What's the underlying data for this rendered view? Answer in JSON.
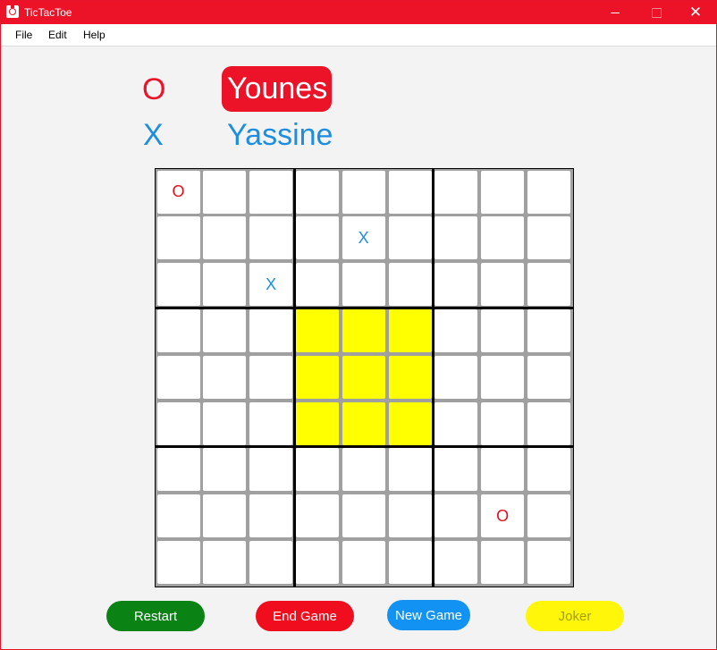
{
  "window": {
    "title": "TicTacToe",
    "close_glyph": "✕"
  },
  "menu": [
    "File",
    "Edit",
    "Help"
  ],
  "players": [
    {
      "symbol": "O",
      "name": "Younes",
      "color": "#ec1328",
      "active": true
    },
    {
      "symbol": "X",
      "name": "Yassine",
      "color": "#1c8de0",
      "active": false
    }
  ],
  "board": {
    "size": 9,
    "active_block": {
      "row": 1,
      "col": 1
    },
    "highlight_color": "#ffff00",
    "cells": [
      [
        "O",
        "",
        "",
        "",
        "",
        "",
        "",
        "",
        ""
      ],
      [
        "",
        "",
        "",
        "",
        "X",
        "",
        "",
        "",
        ""
      ],
      [
        "",
        "",
        "X",
        "",
        "",
        "",
        "",
        "",
        ""
      ],
      [
        "",
        "",
        "",
        "",
        "",
        "",
        "",
        "",
        ""
      ],
      [
        "",
        "",
        "",
        "",
        "",
        "",
        "",
        "",
        ""
      ],
      [
        "",
        "",
        "",
        "",
        "",
        "",
        "",
        "",
        ""
      ],
      [
        "",
        "",
        "",
        "",
        "",
        "",
        "",
        "",
        ""
      ],
      [
        "",
        "",
        "",
        "",
        "",
        "",
        "",
        "O",
        ""
      ],
      [
        "",
        "",
        "",
        "",
        "",
        "",
        "",
        "",
        ""
      ]
    ]
  },
  "buttons": {
    "restart": "Restart",
    "end_game": "End Game",
    "new_game": "New Game",
    "joker": "Joker"
  },
  "colors": {
    "titlebar": "#ec1328",
    "restart": "#0a8214",
    "end_game": "#ef0d1e",
    "new_game": "#1293f4",
    "joker": "#fff60a"
  }
}
